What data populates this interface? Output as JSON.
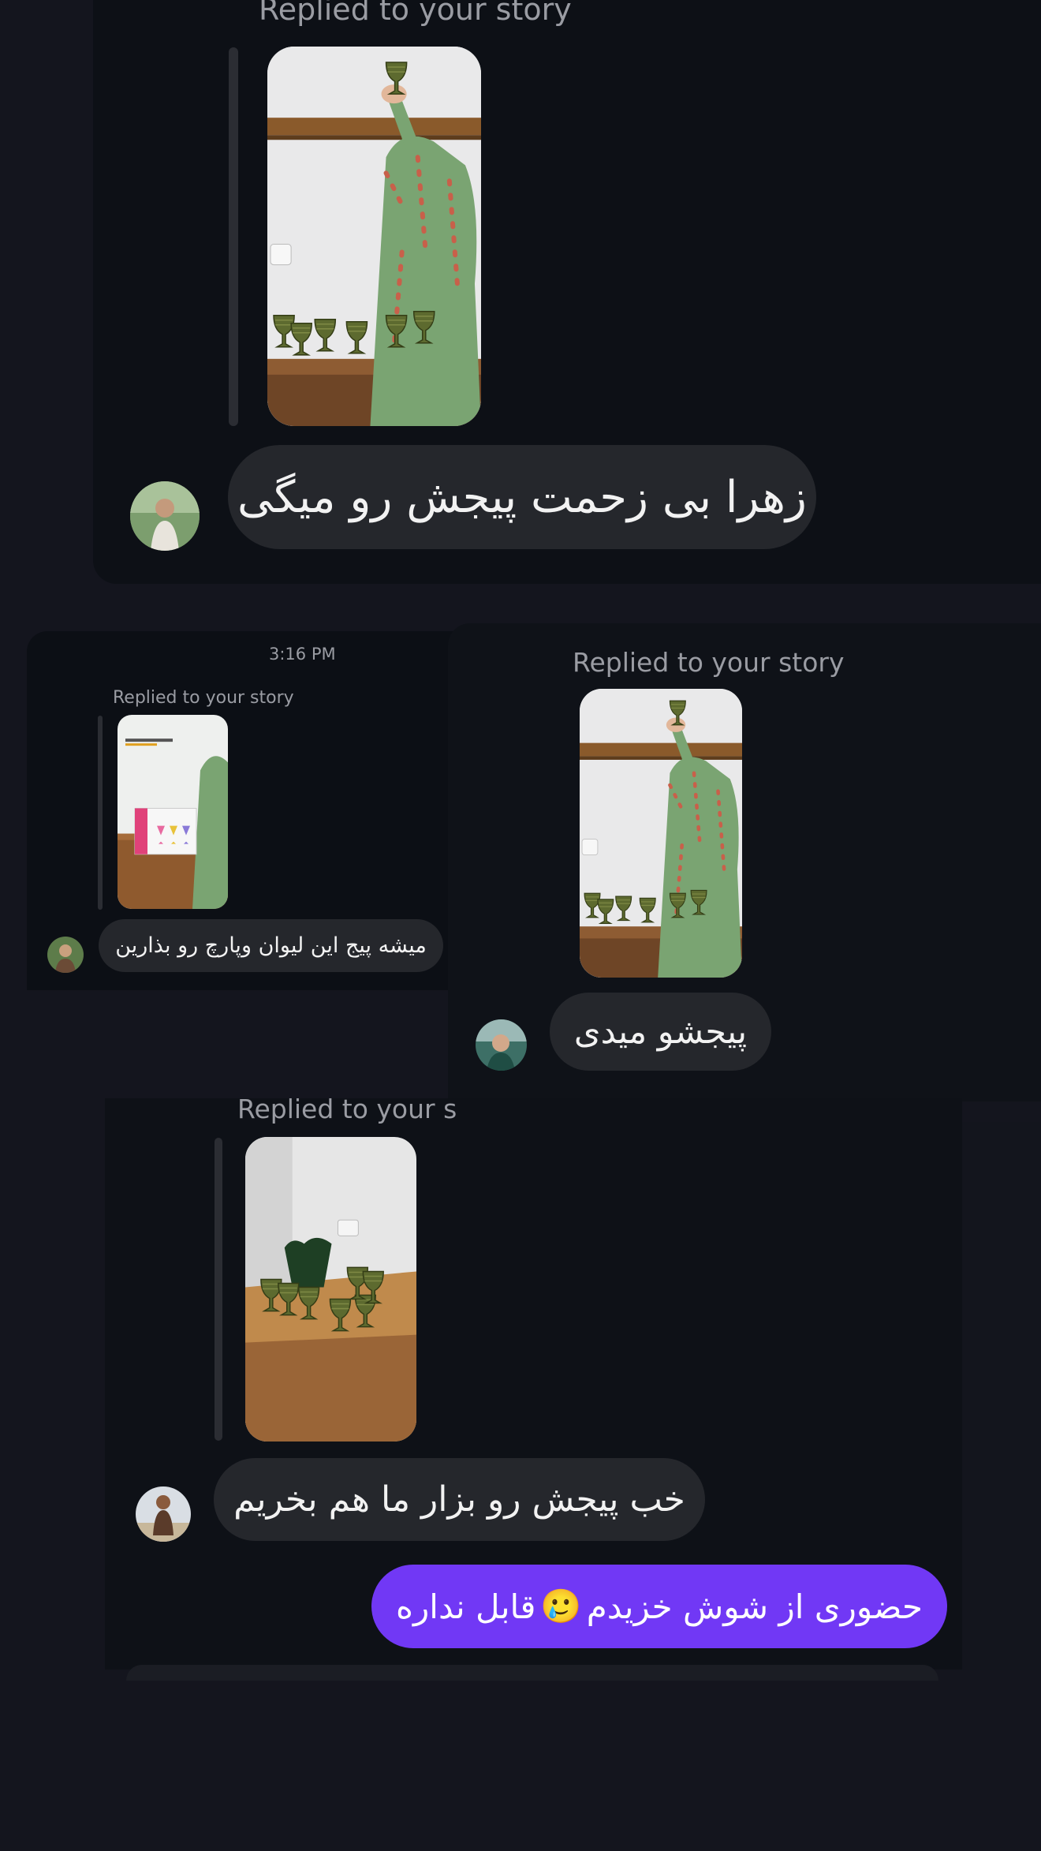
{
  "colors": {
    "background": "#14151e",
    "panel": "#0d1016",
    "incoming_bubble": "#25272c",
    "outgoing_bubble": "#7138f5",
    "meta_text": "#9a9ca3"
  },
  "thread1": {
    "replied_label": "Replied to your story",
    "story_thumb": "story-glasses-shelf",
    "avatar": "avatar-woman-plants",
    "message": "زهرا بی زحمت پیجش رو میگی"
  },
  "thread2": {
    "timestamp": "3:16 PM",
    "replied_label": "Replied to your story",
    "story_thumb": "story-glasses-box",
    "avatar": "avatar-man-outdoors",
    "message": "میشه پیج این لیوان وپارچ رو بذارین"
  },
  "thread3": {
    "replied_label": "Replied to your story",
    "story_thumb": "story-glasses-shelf",
    "avatar": "avatar-woman-car",
    "message": "پیجشو میدی"
  },
  "thread4": {
    "replied_label": "Replied to your s",
    "story_thumb": "story-glasses-counter",
    "avatar": "avatar-person-beach",
    "message": "خب پیجش رو بزار ما هم بخریم",
    "reply": {
      "text": "حضوری از شوش خزیدم",
      "emoji": "🥲",
      "text_after": "قابل نداره"
    }
  }
}
